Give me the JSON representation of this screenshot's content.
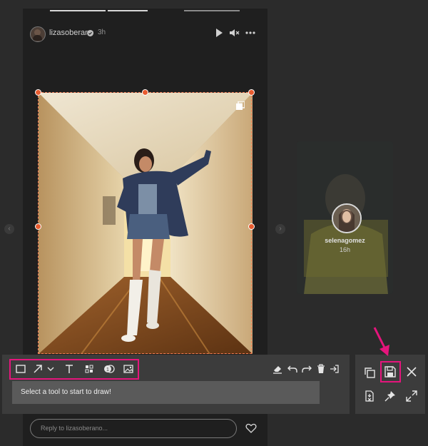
{
  "story": {
    "username": "lizasoberano",
    "time": "3h",
    "header_icons": [
      "play-icon",
      "mute-icon",
      "more-icon"
    ],
    "reply_placeholder": "Reply to lizasoberano..."
  },
  "side_story": {
    "username": "selenagomez",
    "time": "16h"
  },
  "drawing_toolbar": {
    "tools": [
      "rectangle-tool-icon",
      "arrow-tool-icon",
      "chevron-down-icon",
      "text-tool-icon",
      "pixelate-tool-icon",
      "step-counter-tool-icon",
      "image-tool-icon"
    ],
    "actions": [
      "eraser-icon",
      "undo-icon",
      "redo-icon",
      "trash-icon",
      "exit-icon"
    ],
    "status_text": "Select a tool to start to draw!"
  },
  "side_panel": {
    "buttons": [
      "copy-icon",
      "save-icon",
      "close-icon",
      "document-check-icon",
      "pin-icon",
      "expand-icon"
    ]
  },
  "colors": {
    "highlight": "#e5157c",
    "selection": "#f27b53"
  }
}
